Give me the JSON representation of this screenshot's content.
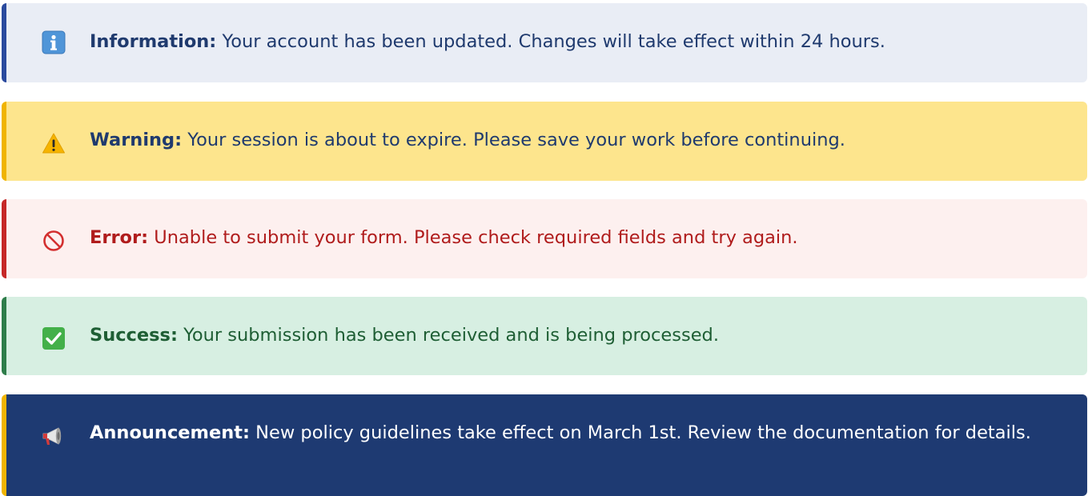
{
  "alerts": {
    "info": {
      "icon": "info-icon",
      "title": "Information:",
      "message": " Your account has been updated. Changes will take effect within 24 hours.",
      "colors": {
        "background": "#e9edf5",
        "border": "#2a4a9e",
        "title": "#1f3a6e",
        "text": "#1f3a6e"
      }
    },
    "warning": {
      "icon": "warning-icon",
      "title": "Warning:",
      "message": " Your session is about to expire. Please save your work before continuing.",
      "colors": {
        "background": "#fde58d",
        "border": "#f0b400",
        "title": "#1f3a6e",
        "text": "#1f3a6e"
      }
    },
    "error": {
      "icon": "prohibited-icon",
      "title": "Error:",
      "message": " Unable to submit your form. Please check required fields and try again.",
      "colors": {
        "background": "#fdf0ef",
        "border": "#c62828",
        "title": "#b01c1c",
        "text": "#b01c1c"
      }
    },
    "success": {
      "icon": "check-mark-icon",
      "title": "Success:",
      "message": " Your submission has been received and is being processed.",
      "colors": {
        "background": "#d7efe2",
        "border": "#2e7d4a",
        "title": "#1e5e34",
        "text": "#1e5e34"
      }
    },
    "announcement": {
      "icon": "megaphone-icon",
      "title": "Announcement:",
      "message": " New policy guidelines take effect on March 1st. Review the documentation for details.",
      "colors": {
        "background": "#1e3a72",
        "border": "#f0b400",
        "title": "#ffffff",
        "text": "#ffffff"
      }
    }
  }
}
